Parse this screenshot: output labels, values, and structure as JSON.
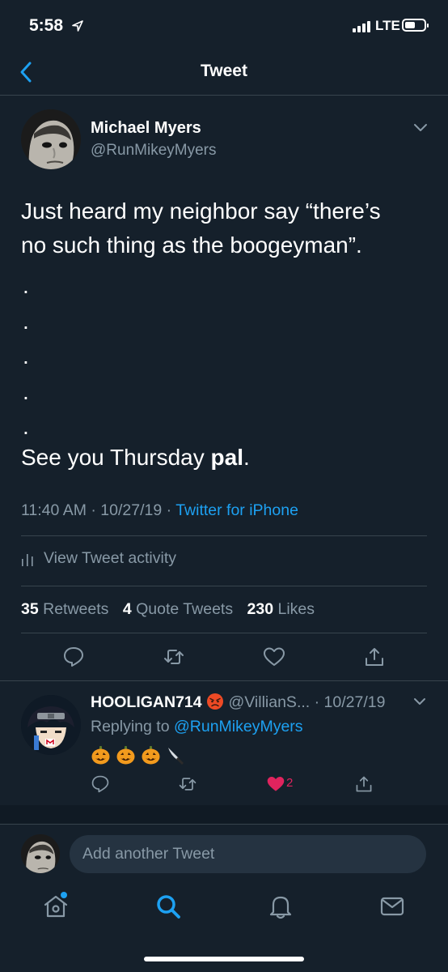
{
  "status_bar": {
    "time": "5:58",
    "network": "LTE"
  },
  "nav": {
    "title": "Tweet"
  },
  "tweet": {
    "author_name": "Michael Myers",
    "author_handle": "@RunMikeyMyers",
    "text_line1": "Just heard my neighbor say “there’s",
    "text_line2": "no such thing as the boogeyman”.",
    "dots": [
      ".",
      ".",
      ".",
      ".",
      "."
    ],
    "closing_prefix": "See you Thursday ",
    "closing_bold": "pal",
    "closing_suffix": ".",
    "time": "11:40 AM",
    "date": "10/27/19",
    "source": "Twitter for iPhone",
    "activity_label": "View Tweet activity",
    "retweets_count": "35",
    "retweets_label": "Retweets",
    "quotes_count": "4",
    "quotes_label": "Quote Tweets",
    "likes_count": "230",
    "likes_label": "Likes"
  },
  "reply": {
    "name": "HOOLIGAN714",
    "name_emoji": "angry-face",
    "handle": "@VillianS...",
    "date": "10/27/19",
    "replying_prefix": "Replying to ",
    "replying_handle": "@RunMikeyMyers",
    "emojis": [
      "jack-o-lantern",
      "jack-o-lantern",
      "jack-o-lantern",
      "kitchen-knife"
    ],
    "like_count": "2"
  },
  "compose": {
    "placeholder": "Add another Tweet"
  },
  "colors": {
    "background": "#15202b",
    "accent": "#1da1f2",
    "secondary_text": "#8899a6",
    "divider": "#38444d",
    "like": "#e0245e"
  },
  "tabs": [
    "home-icon",
    "search-icon",
    "notifications-icon",
    "messages-icon"
  ]
}
